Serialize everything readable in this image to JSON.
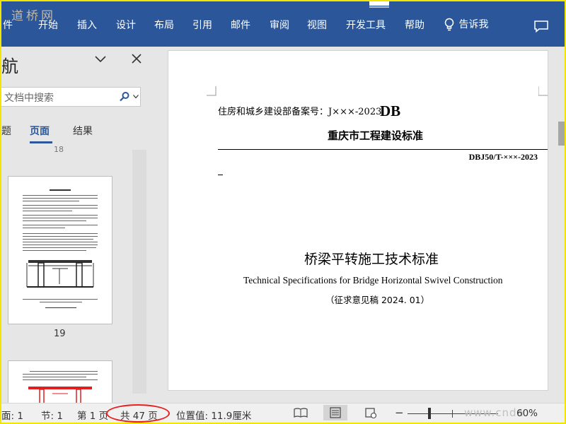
{
  "ribbon": {
    "watermark": "道桥网",
    "tabs": [
      "件",
      "开始",
      "插入",
      "设计",
      "布局",
      "引用",
      "邮件",
      "审阅",
      "视图",
      "开发工具",
      "帮助"
    ],
    "tell_me": "告诉我"
  },
  "nav": {
    "title": "航",
    "search_placeholder": "文档中搜索",
    "tabs": [
      "题",
      "页面",
      "结果"
    ],
    "page_labels": [
      "18",
      "19"
    ]
  },
  "document": {
    "record_no": "住房和城乡建设部备案号：J×××-2023",
    "db_mark": "DB",
    "org": "重庆市工程建设标准",
    "code": "DBJ50/T-×××-2023",
    "title_cn": "桥梁平转施工技术标准",
    "title_en": "Technical Specifications for Bridge Horizontal Swivel Construction",
    "draft_note": "（征求意见稿 2024. 01）"
  },
  "status": {
    "page": "面: 1",
    "section": "节: 1",
    "page_of": "第 1 页",
    "total": "共 47 页",
    "position": "位置值: 11.9厘米",
    "zoom": "60%",
    "zoom_minus": "−",
    "watermark": "www.cnda"
  },
  "colors": {
    "ribbon": "#2b579a",
    "frame": "#f2e600",
    "highlight": "#e81e1e"
  }
}
